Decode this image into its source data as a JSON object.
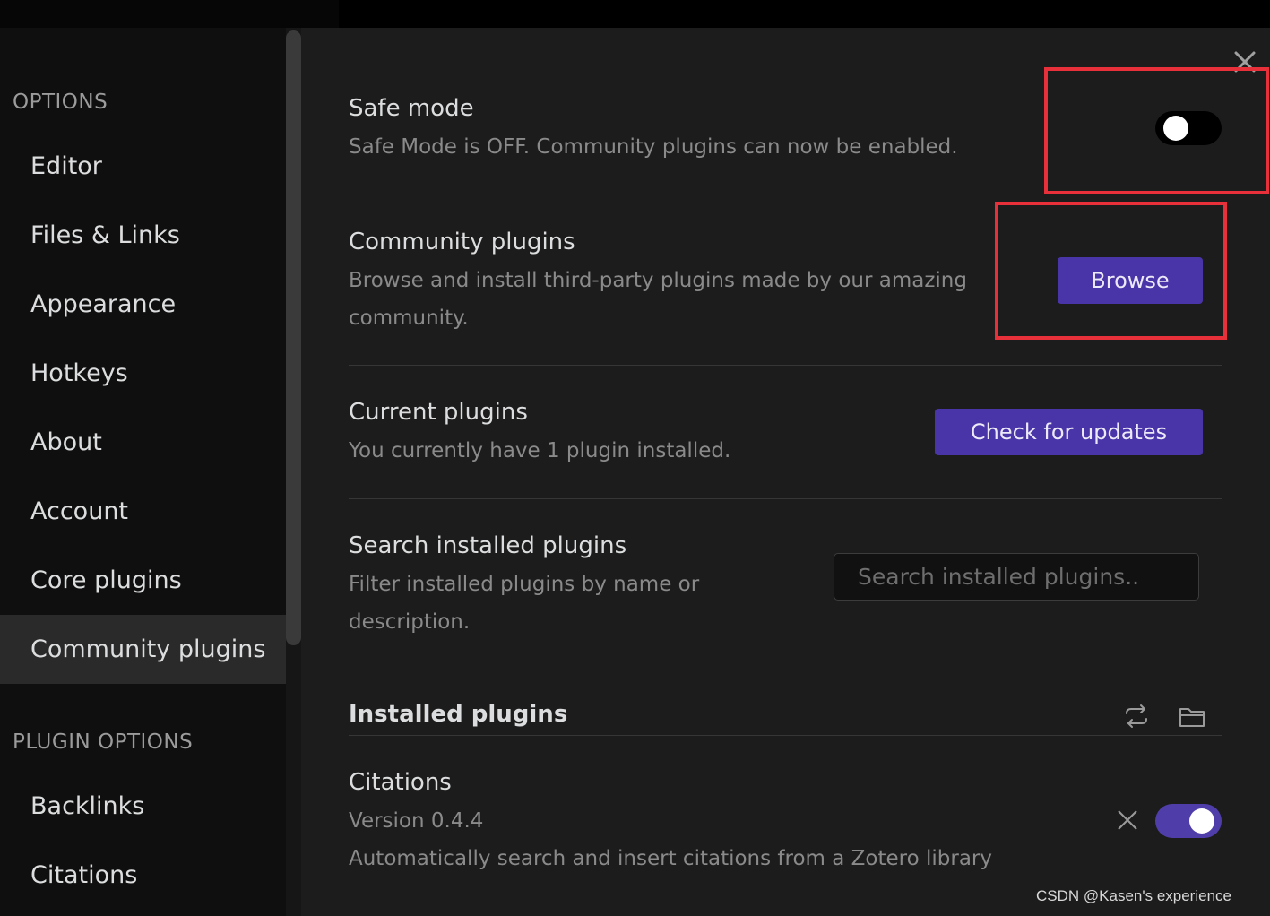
{
  "sidebar": {
    "options_heading": "OPTIONS",
    "options_items": [
      {
        "label": "Editor"
      },
      {
        "label": "Files & Links"
      },
      {
        "label": "Appearance"
      },
      {
        "label": "Hotkeys"
      },
      {
        "label": "About"
      },
      {
        "label": "Account"
      },
      {
        "label": "Core plugins"
      },
      {
        "label": "Community plugins",
        "active": true
      }
    ],
    "plugin_options_heading": "PLUGIN OPTIONS",
    "plugin_items": [
      {
        "label": "Backlinks"
      },
      {
        "label": "Citations"
      }
    ]
  },
  "settings": {
    "safe_mode": {
      "name": "Safe mode",
      "description": "Safe Mode is OFF. Community plugins can now be enabled.",
      "toggle_on": false
    },
    "community_plugins": {
      "name": "Community plugins",
      "description": "Browse and install third-party plugins made by our amazing community.",
      "button_label": "Browse"
    },
    "current_plugins": {
      "name": "Current plugins",
      "description": "You currently have 1 plugin installed.",
      "button_label": "Check for updates"
    },
    "search_installed": {
      "name": "Search installed plugins",
      "description": "Filter installed plugins by name or description.",
      "placeholder": "Search installed plugins.."
    }
  },
  "installed": {
    "heading": "Installed plugins",
    "icons": [
      "reload-icon",
      "folder-icon"
    ],
    "plugins": [
      {
        "name": "Citations",
        "version": "Version 0.4.4",
        "description": "Automatically search and insert citations from a Zotero library",
        "enabled": true
      }
    ]
  },
  "colors": {
    "accent": "#4a35a8",
    "highlight_box": "#e8303a"
  },
  "watermark": "CSDN @Kasen's experience"
}
